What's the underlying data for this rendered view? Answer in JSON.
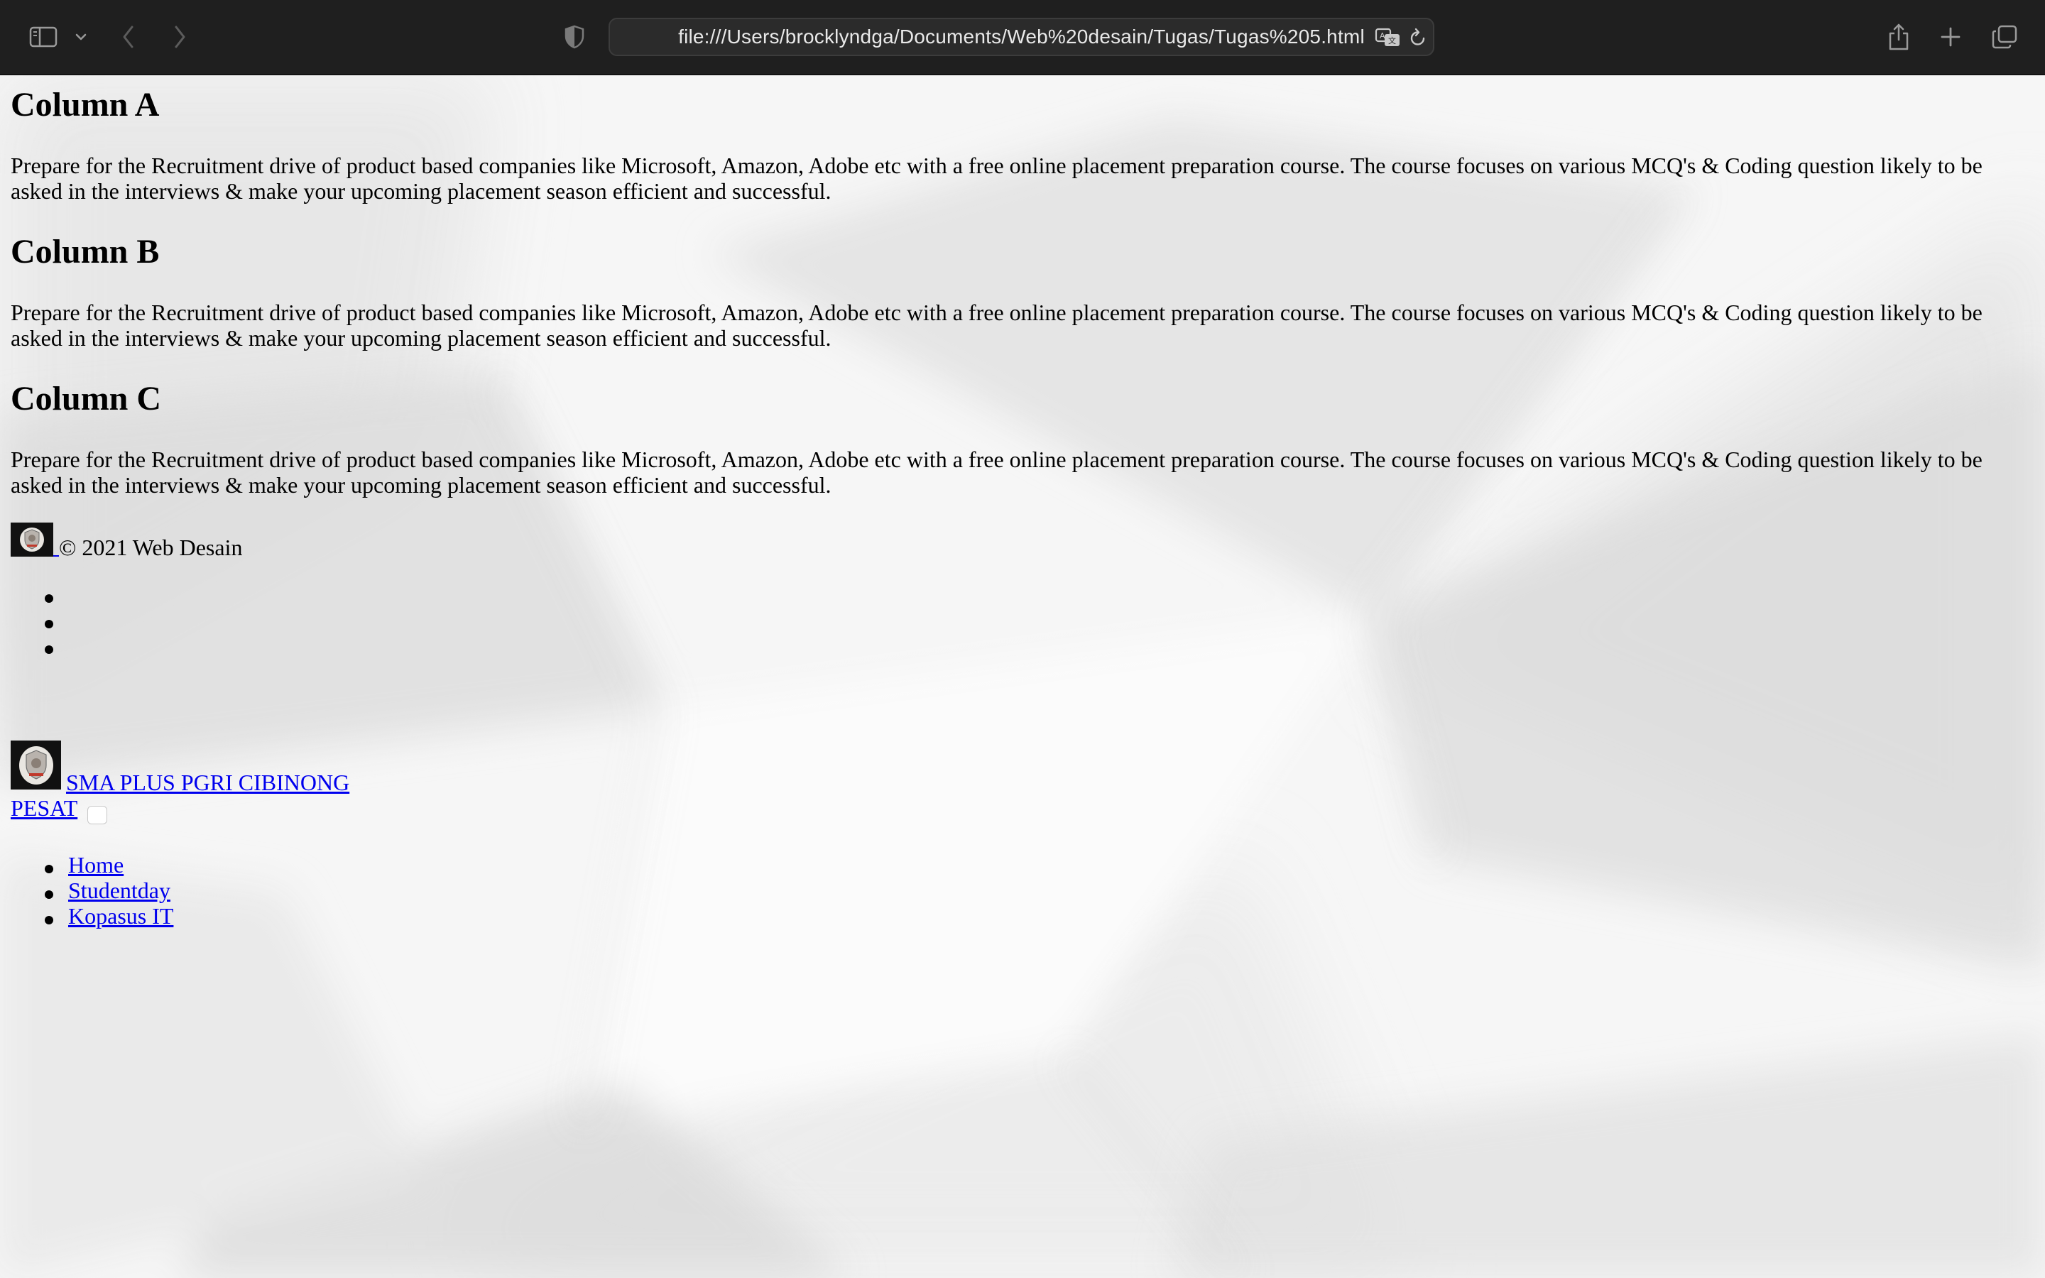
{
  "browser": {
    "url": "file:///Users/brocklyndga/Documents/Web%20desain/Tugas/Tugas%205.html",
    "icons": {
      "sidebar": "sidebar-icon",
      "sidebar_menu": "chevron-down-icon",
      "back": "chevron-left-icon",
      "forward": "chevron-right-icon",
      "privacy": "shield-icon",
      "translate": "translate-icon",
      "reload": "reload-icon",
      "share": "share-icon",
      "new_tab": "plus-icon",
      "tabs": "tabs-overview-icon"
    }
  },
  "page": {
    "columns": [
      {
        "heading": "Column A",
        "text": "Prepare for the Recruitment drive of product based companies like Microsoft, Amazon, Adobe etc with a free online placement preparation course. The course focuses on various MCQ's & Coding question likely to be asked in the interviews & make your upcoming placement season efficient and successful."
      },
      {
        "heading": "Column B",
        "text": "Prepare for the Recruitment drive of product based companies like Microsoft, Amazon, Adobe etc with a free online placement preparation course. The course focuses on various MCQ's & Coding question likely to be asked in the interviews & make your upcoming placement season efficient and successful."
      },
      {
        "heading": "Column C",
        "text": "Prepare for the Recruitment drive of product based companies like Microsoft, Amazon, Adobe etc with a free online placement preparation course. The course focuses on various MCQ's & Coding question likely to be asked in the interviews & make your upcoming placement season efficient and successful."
      }
    ],
    "footer": {
      "copyright": "© 2021 Web Desain",
      "social_items_count": 3
    },
    "navbar": {
      "brand_line1": "SMA PLUS PGRI CIBINONG",
      "brand_line2": "PESAT",
      "links": [
        "Home",
        "Studentday",
        "Kopasus IT"
      ]
    }
  }
}
